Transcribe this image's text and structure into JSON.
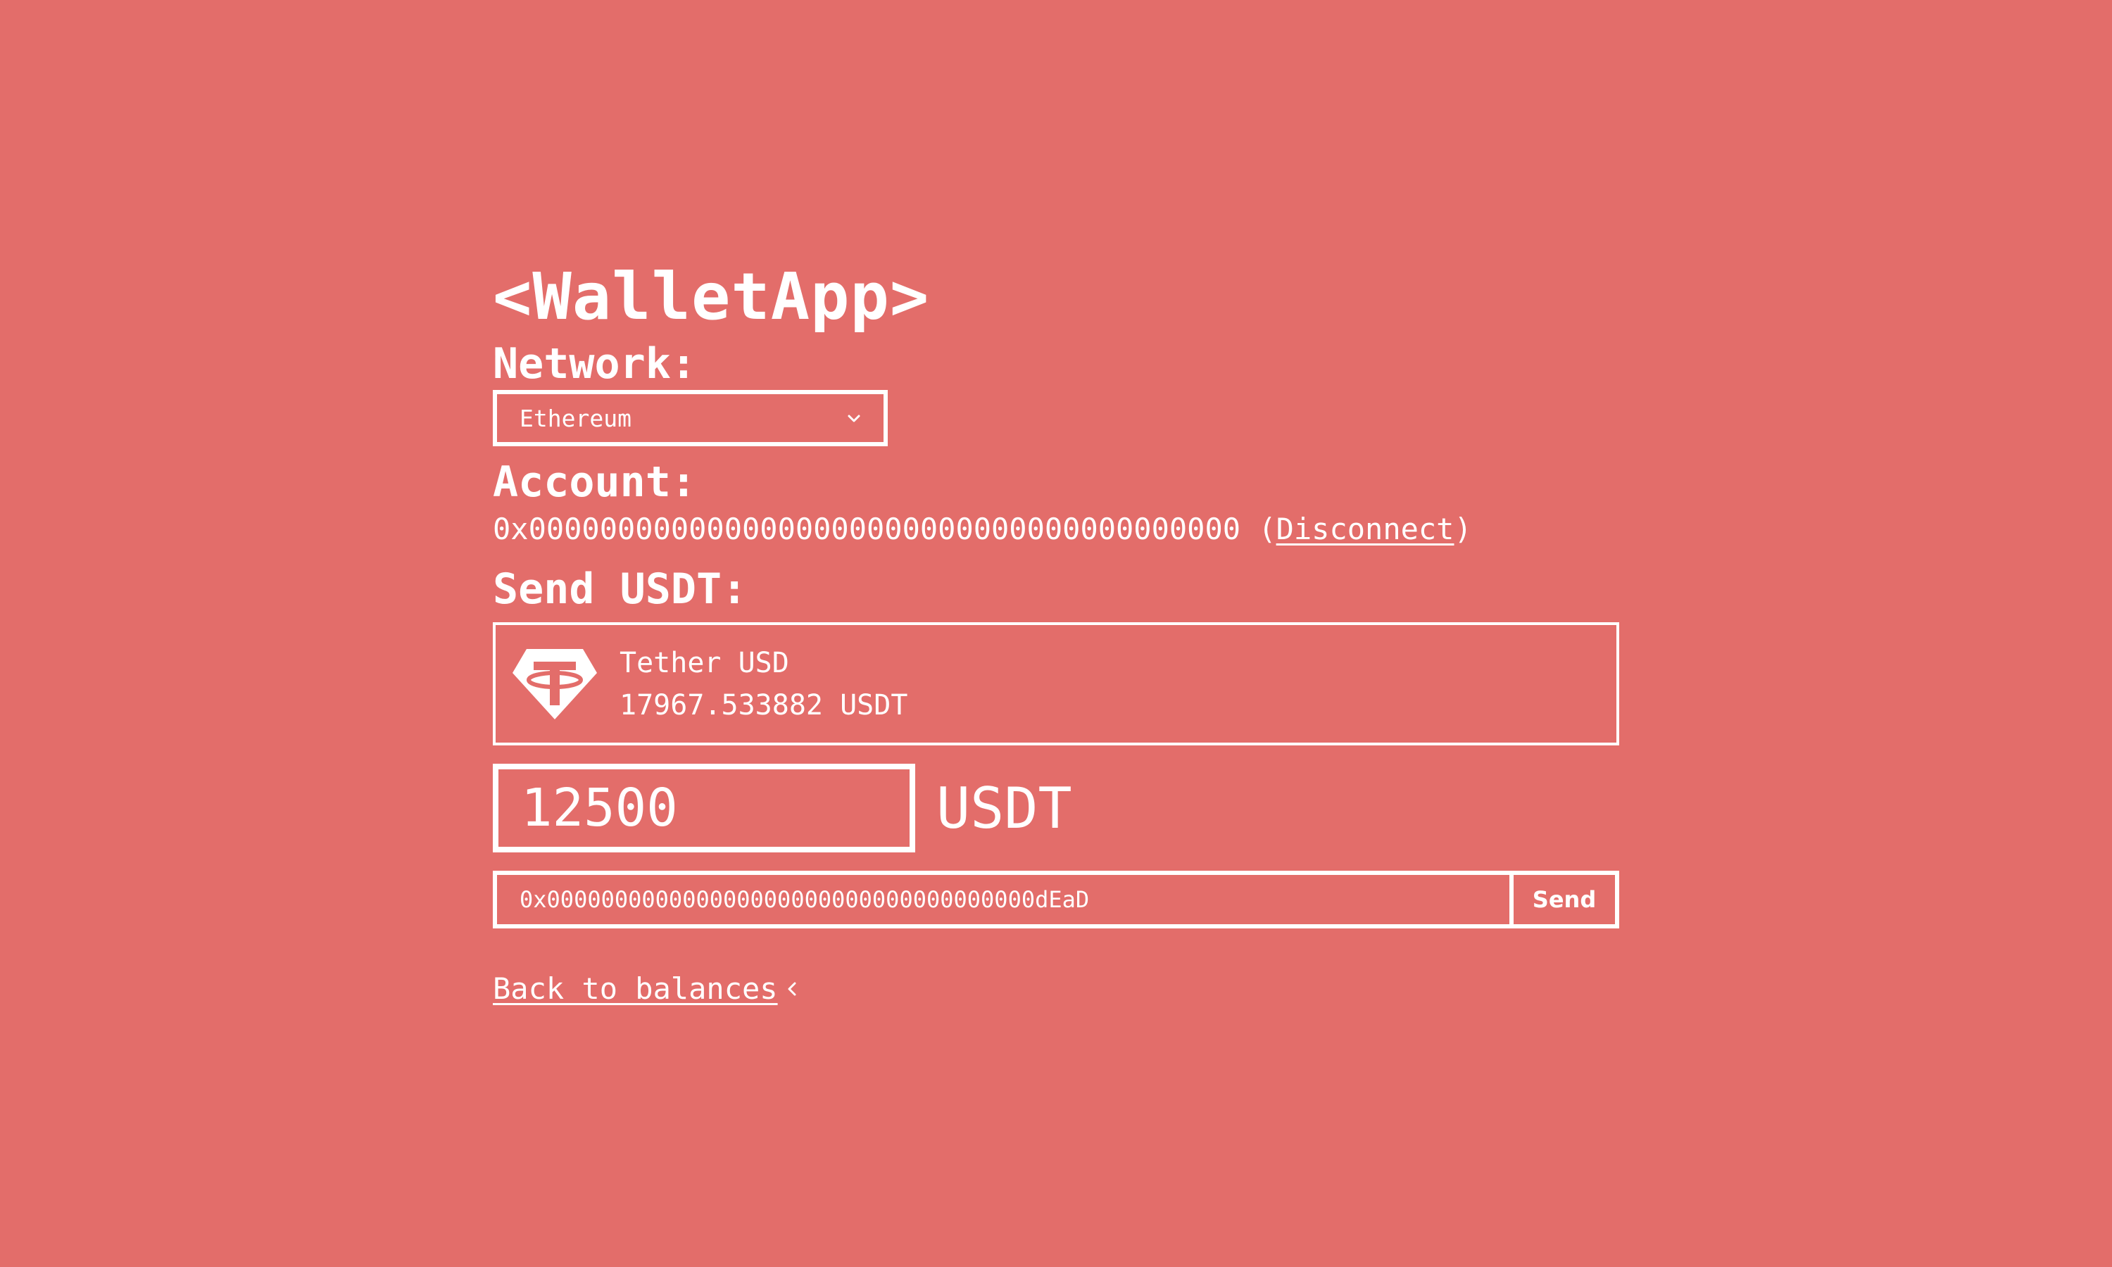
{
  "app": {
    "title": "<WalletApp>"
  },
  "network": {
    "label": "Network:",
    "selected": "Ethereum"
  },
  "account": {
    "label": "Account:",
    "address": "0x0000000000000000000000000000000000000000",
    "open_paren": " (",
    "disconnect_label": "Disconnect",
    "close_paren": ")"
  },
  "send": {
    "label": "Send USDT:",
    "token": {
      "name": "Tether USD",
      "balance": "17967.533882 USDT",
      "icon": "tether-logo-icon"
    },
    "amount": "12500",
    "amount_unit": "USDT",
    "recipient": "0x000000000000000000000000000000000000dEaD",
    "send_label": "Send"
  },
  "back": {
    "label": "Back to balances"
  },
  "colors": {
    "background": "#e36d6a",
    "foreground": "#ffffff"
  }
}
